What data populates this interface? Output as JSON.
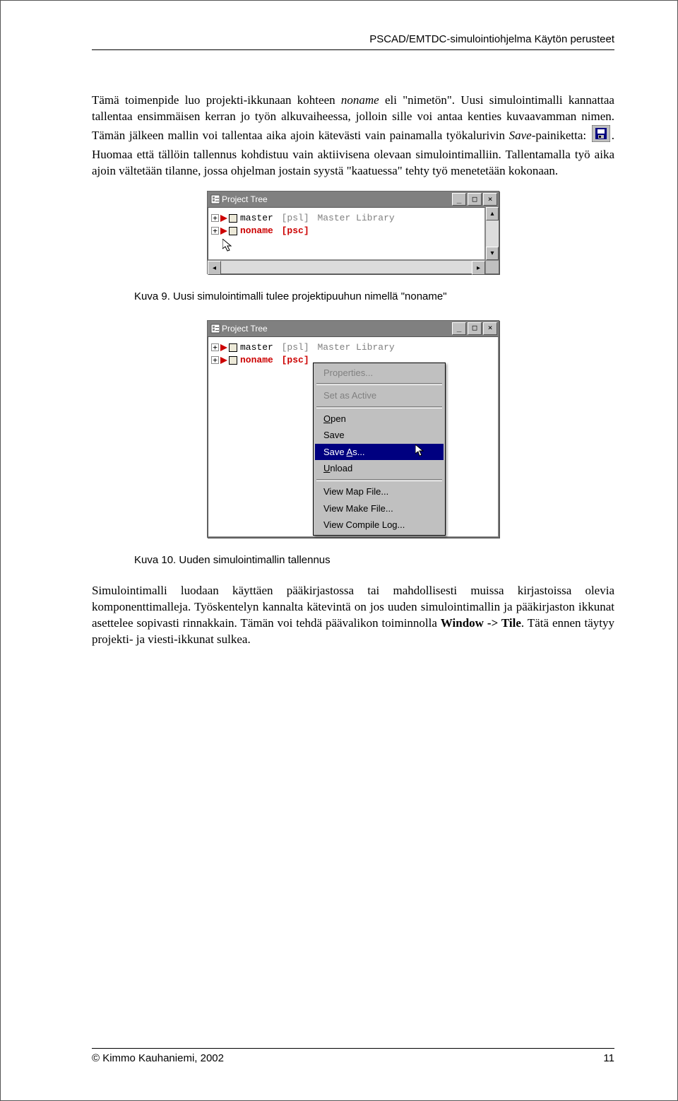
{
  "header": {
    "running_title": "PSCAD/EMTDC-simulointiohjelma Käytön perusteet"
  },
  "paragraphs": {
    "p1a": "Tämä toimenpide luo projekti-ikkunaan kohteen ",
    "p1_noname": "noname",
    "p1b": " eli \"nimetön\". Uusi simulointimalli kannattaa tallentaa ensimmäisen kerran jo työn alkuvaiheessa, jolloin sille voi antaa kenties kuvaavamman nimen. Tämän jälkeen mallin voi tallentaa aika ajoin kätevästi vain painamalla työkalurivin ",
    "p1_save": "Save",
    "p1c": "-painiketta: ",
    "p1d": ". Huomaa että tällöin tallennus kohdistuu vain aktiivisena olevaan simulointimalliin. Tallentamalla työ aika ajoin vältetään tilanne, jossa ohjelman jostain syystä \"kaatuessa\" tehty työ menetetään kokonaan.",
    "p2a": "Simulointimalli luodaan käyttäen pääkirjastossa tai mahdollisesti muissa kirjastoissa olevia komponenttimalleja. Työskentelyn kannalta kätevintä on jos uuden simulointimallin ja pääkirjaston ikkunat asettelee sopivasti rinnakkain. Tämän voi tehdä päävalikon toiminnolla ",
    "p2_menu": "Window -> Tile",
    "p2b": ". Tätä ennen täytyy projekti- ja viesti-ikkunat sulkea."
  },
  "figures": {
    "fig9_caption": "Kuva 9. Uusi simulointimalli tulee projektipuuhun nimellä \"noname\"",
    "fig10_caption": "Kuva 10. Uuden simulointimallin tallennus"
  },
  "project_tree": {
    "title": "Project Tree",
    "items": [
      {
        "name": "master",
        "ext": "[psl]",
        "desc": "Master Library",
        "kind": "psl"
      },
      {
        "name": "noname",
        "ext": "[psc]",
        "desc": "",
        "kind": "psc"
      }
    ]
  },
  "context_menu": {
    "items": [
      {
        "label": "Properties...",
        "disabled": true,
        "u": ""
      },
      {
        "sep": true
      },
      {
        "label": "Set as Active",
        "disabled": true,
        "u": ""
      },
      {
        "sep": true
      },
      {
        "label": "Open",
        "u": "O"
      },
      {
        "label": "Save",
        "u": ""
      },
      {
        "label": "Save As...",
        "u": "A",
        "highlight": true
      },
      {
        "label": "Unload",
        "u": "U"
      },
      {
        "sep": true
      },
      {
        "label": "View Map File...",
        "u": ""
      },
      {
        "label": "View Make File...",
        "u": ""
      },
      {
        "label": "View Compile Log...",
        "u": ""
      }
    ]
  },
  "footer": {
    "left": "© Kimmo Kauhaniemi, 2002",
    "right": "11"
  }
}
